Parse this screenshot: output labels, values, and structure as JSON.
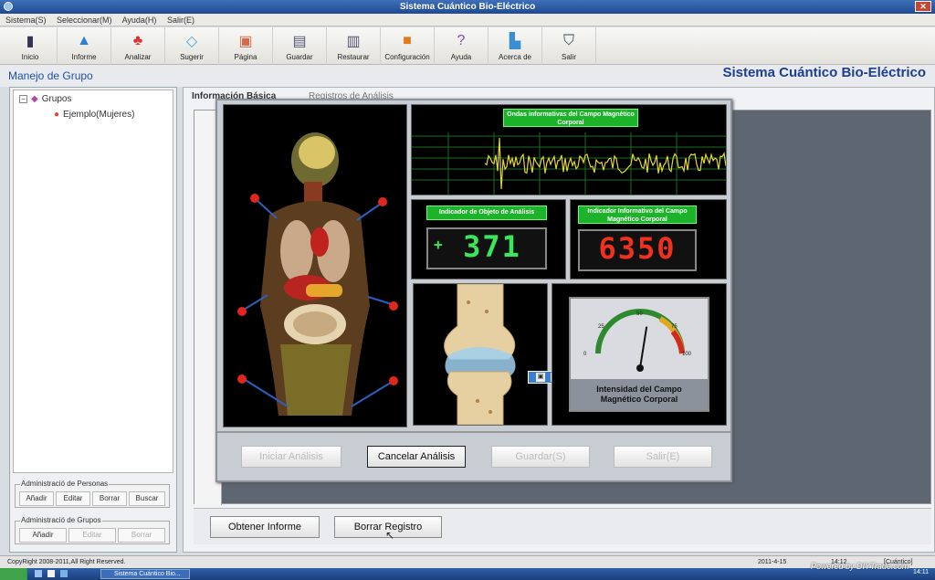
{
  "window": {
    "title": "Sistema Cuántico Bio-Eléctrico"
  },
  "menu": [
    "Sistema(S)",
    "Seleccionar(M)",
    "Ayuda(H)",
    "Salir(E)"
  ],
  "toolbar": [
    {
      "label": "Inicio",
      "icon": "home-icon"
    },
    {
      "label": "Informe",
      "icon": "report-icon"
    },
    {
      "label": "Analizar",
      "icon": "analyze-icon"
    },
    {
      "label": "Sugerir",
      "icon": "suggest-icon"
    },
    {
      "label": "Página",
      "icon": "page-icon"
    },
    {
      "label": "Guardar",
      "icon": "save-icon"
    },
    {
      "label": "Restaurar",
      "icon": "restore-icon"
    },
    {
      "label": "Configuración",
      "icon": "settings-icon"
    },
    {
      "label": "Ayuda",
      "icon": "help-icon"
    },
    {
      "label": "Acerca de",
      "icon": "about-icon"
    },
    {
      "label": "Salir",
      "icon": "exit-icon"
    }
  ],
  "header": {
    "left": "Manejo de Grupo",
    "right": "Sistema Cuántico Bio-Eléctrico"
  },
  "tree": {
    "root": "Grupos",
    "child": "Ejemplo(Mujeres)"
  },
  "persons_admin": {
    "title": "Administració de Personas",
    "buttons": [
      "Añadir",
      "Editar",
      "Borrar",
      "Buscar"
    ]
  },
  "groups_admin": {
    "title": "Administració de Grupos",
    "buttons": [
      "Añadir",
      "Editar",
      "Borrar"
    ]
  },
  "tabs": [
    "Información Básica",
    "Registros de Análisis"
  ],
  "dialog": {
    "wave_label": "Ondas informativas del Campo Magnético Corporal",
    "object_label": "Indicador de Objeto de Análisis",
    "object_value": "371",
    "object_sign": "+",
    "info_label": "Indicador Informativo del Campo Magnético Corporal",
    "info_value": "6350",
    "gauge_ticks": [
      "0",
      "25",
      "50",
      "75",
      "100"
    ],
    "gauge_value": 55,
    "gauge_caption": "Intensidad del Campo Magnético Corporal",
    "buttons": [
      "Iniciar Análisis",
      "Cancelar Análisis",
      "Guardar(S)",
      "Salir(E)"
    ]
  },
  "bottom_buttons": [
    "Obtener Informe",
    "Borrar Registro"
  ],
  "status": {
    "copyright": "CopyRight 2008-2011,All Right Reserved.",
    "date": "2011-4-15",
    "time": "14:12",
    "mode": "[Cuántico]"
  },
  "taskbar": {
    "task": "Sistema Cuántico Bio...",
    "clock": "14:11"
  },
  "watermark": "Powered by DIYTrade.com",
  "colors": {
    "accent": "#2150a6",
    "lcd_green": "#38e85a",
    "lcd_red": "#f0311e",
    "label_green": "#1cb32a"
  }
}
